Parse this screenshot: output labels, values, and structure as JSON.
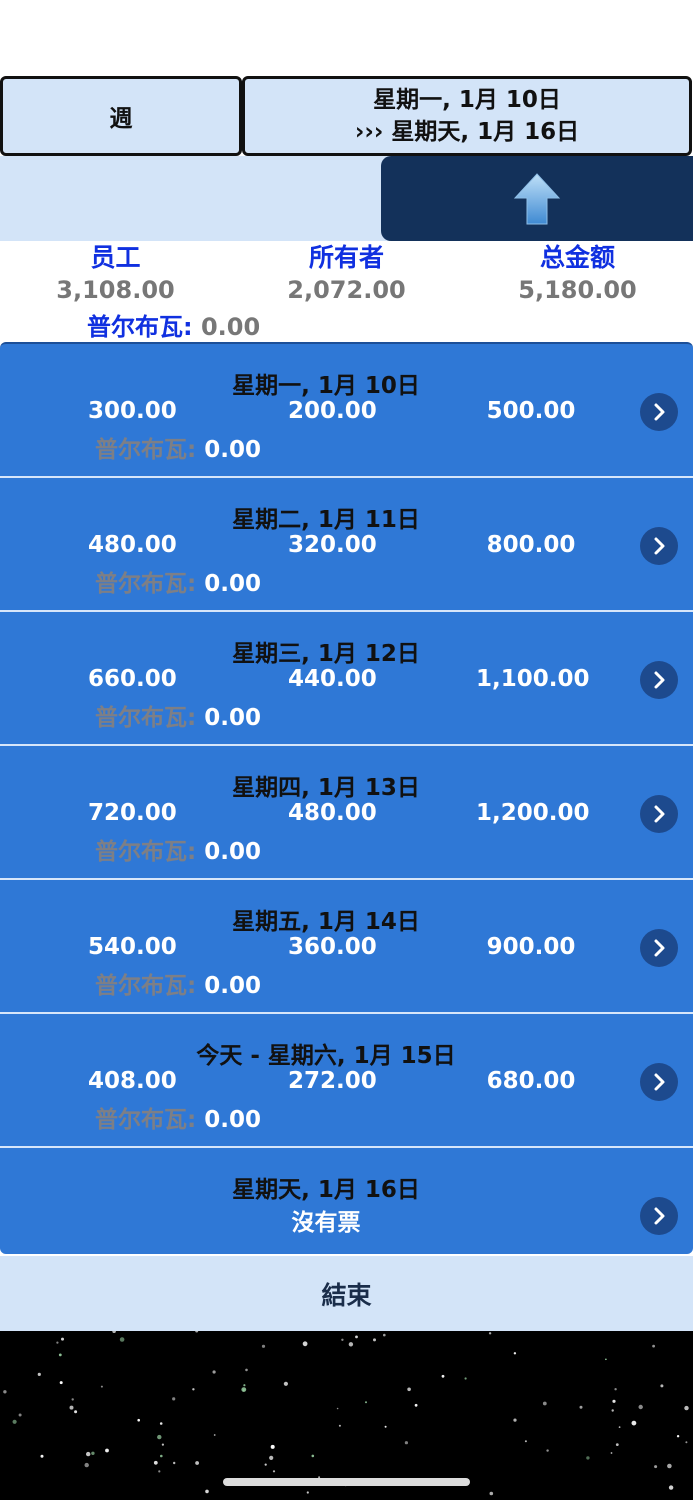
{
  "header": {
    "period_label": "週",
    "range_line1": "星期一, 1月 10日",
    "range_line2": "››› 星期天, 1月 16日"
  },
  "summary": {
    "employee_label": "员工",
    "employee_value": "3,108.00",
    "owner_label": "所有者",
    "owner_value": "2,072.00",
    "total_label": "总金额",
    "total_value": "5,180.00",
    "pool_label": "普尔布瓦:",
    "pool_value": "0.00"
  },
  "days": [
    {
      "title": "星期一, 1月 10日",
      "employee": "300.00",
      "owner": "200.00",
      "total": "500.00",
      "pool_label": "普尔布瓦:",
      "pool_value": "0.00"
    },
    {
      "title": "星期二, 1月 11日",
      "employee": "480.00",
      "owner": "320.00",
      "total": "800.00",
      "pool_label": "普尔布瓦:",
      "pool_value": "0.00"
    },
    {
      "title": "星期三, 1月 12日",
      "employee": "660.00",
      "owner": "440.00",
      "total": "1,100.00",
      "pool_label": "普尔布瓦:",
      "pool_value": "0.00"
    },
    {
      "title": "星期四, 1月 13日",
      "employee": "720.00",
      "owner": "480.00",
      "total": "1,200.00",
      "pool_label": "普尔布瓦:",
      "pool_value": "0.00"
    },
    {
      "title": "星期五, 1月 14日",
      "employee": "540.00",
      "owner": "360.00",
      "total": "900.00",
      "pool_label": "普尔布瓦:",
      "pool_value": "0.00"
    },
    {
      "title": "今天 - 星期六, 1月 15日",
      "employee": "408.00",
      "owner": "272.00",
      "total": "680.00",
      "pool_label": "普尔布瓦:",
      "pool_value": "0.00"
    },
    {
      "title": "星期天, 1月 16日",
      "no_tickets": "沒有票"
    }
  ],
  "footer": {
    "end_label": "結束"
  },
  "colors": {
    "list_blue": "#2f78d6",
    "pale_blue": "#d3e4f8",
    "navy": "#13315a",
    "label_blue": "#1030e0"
  },
  "icons": {
    "up": "up-arrow-icon",
    "row": "chevron-right-icon"
  }
}
